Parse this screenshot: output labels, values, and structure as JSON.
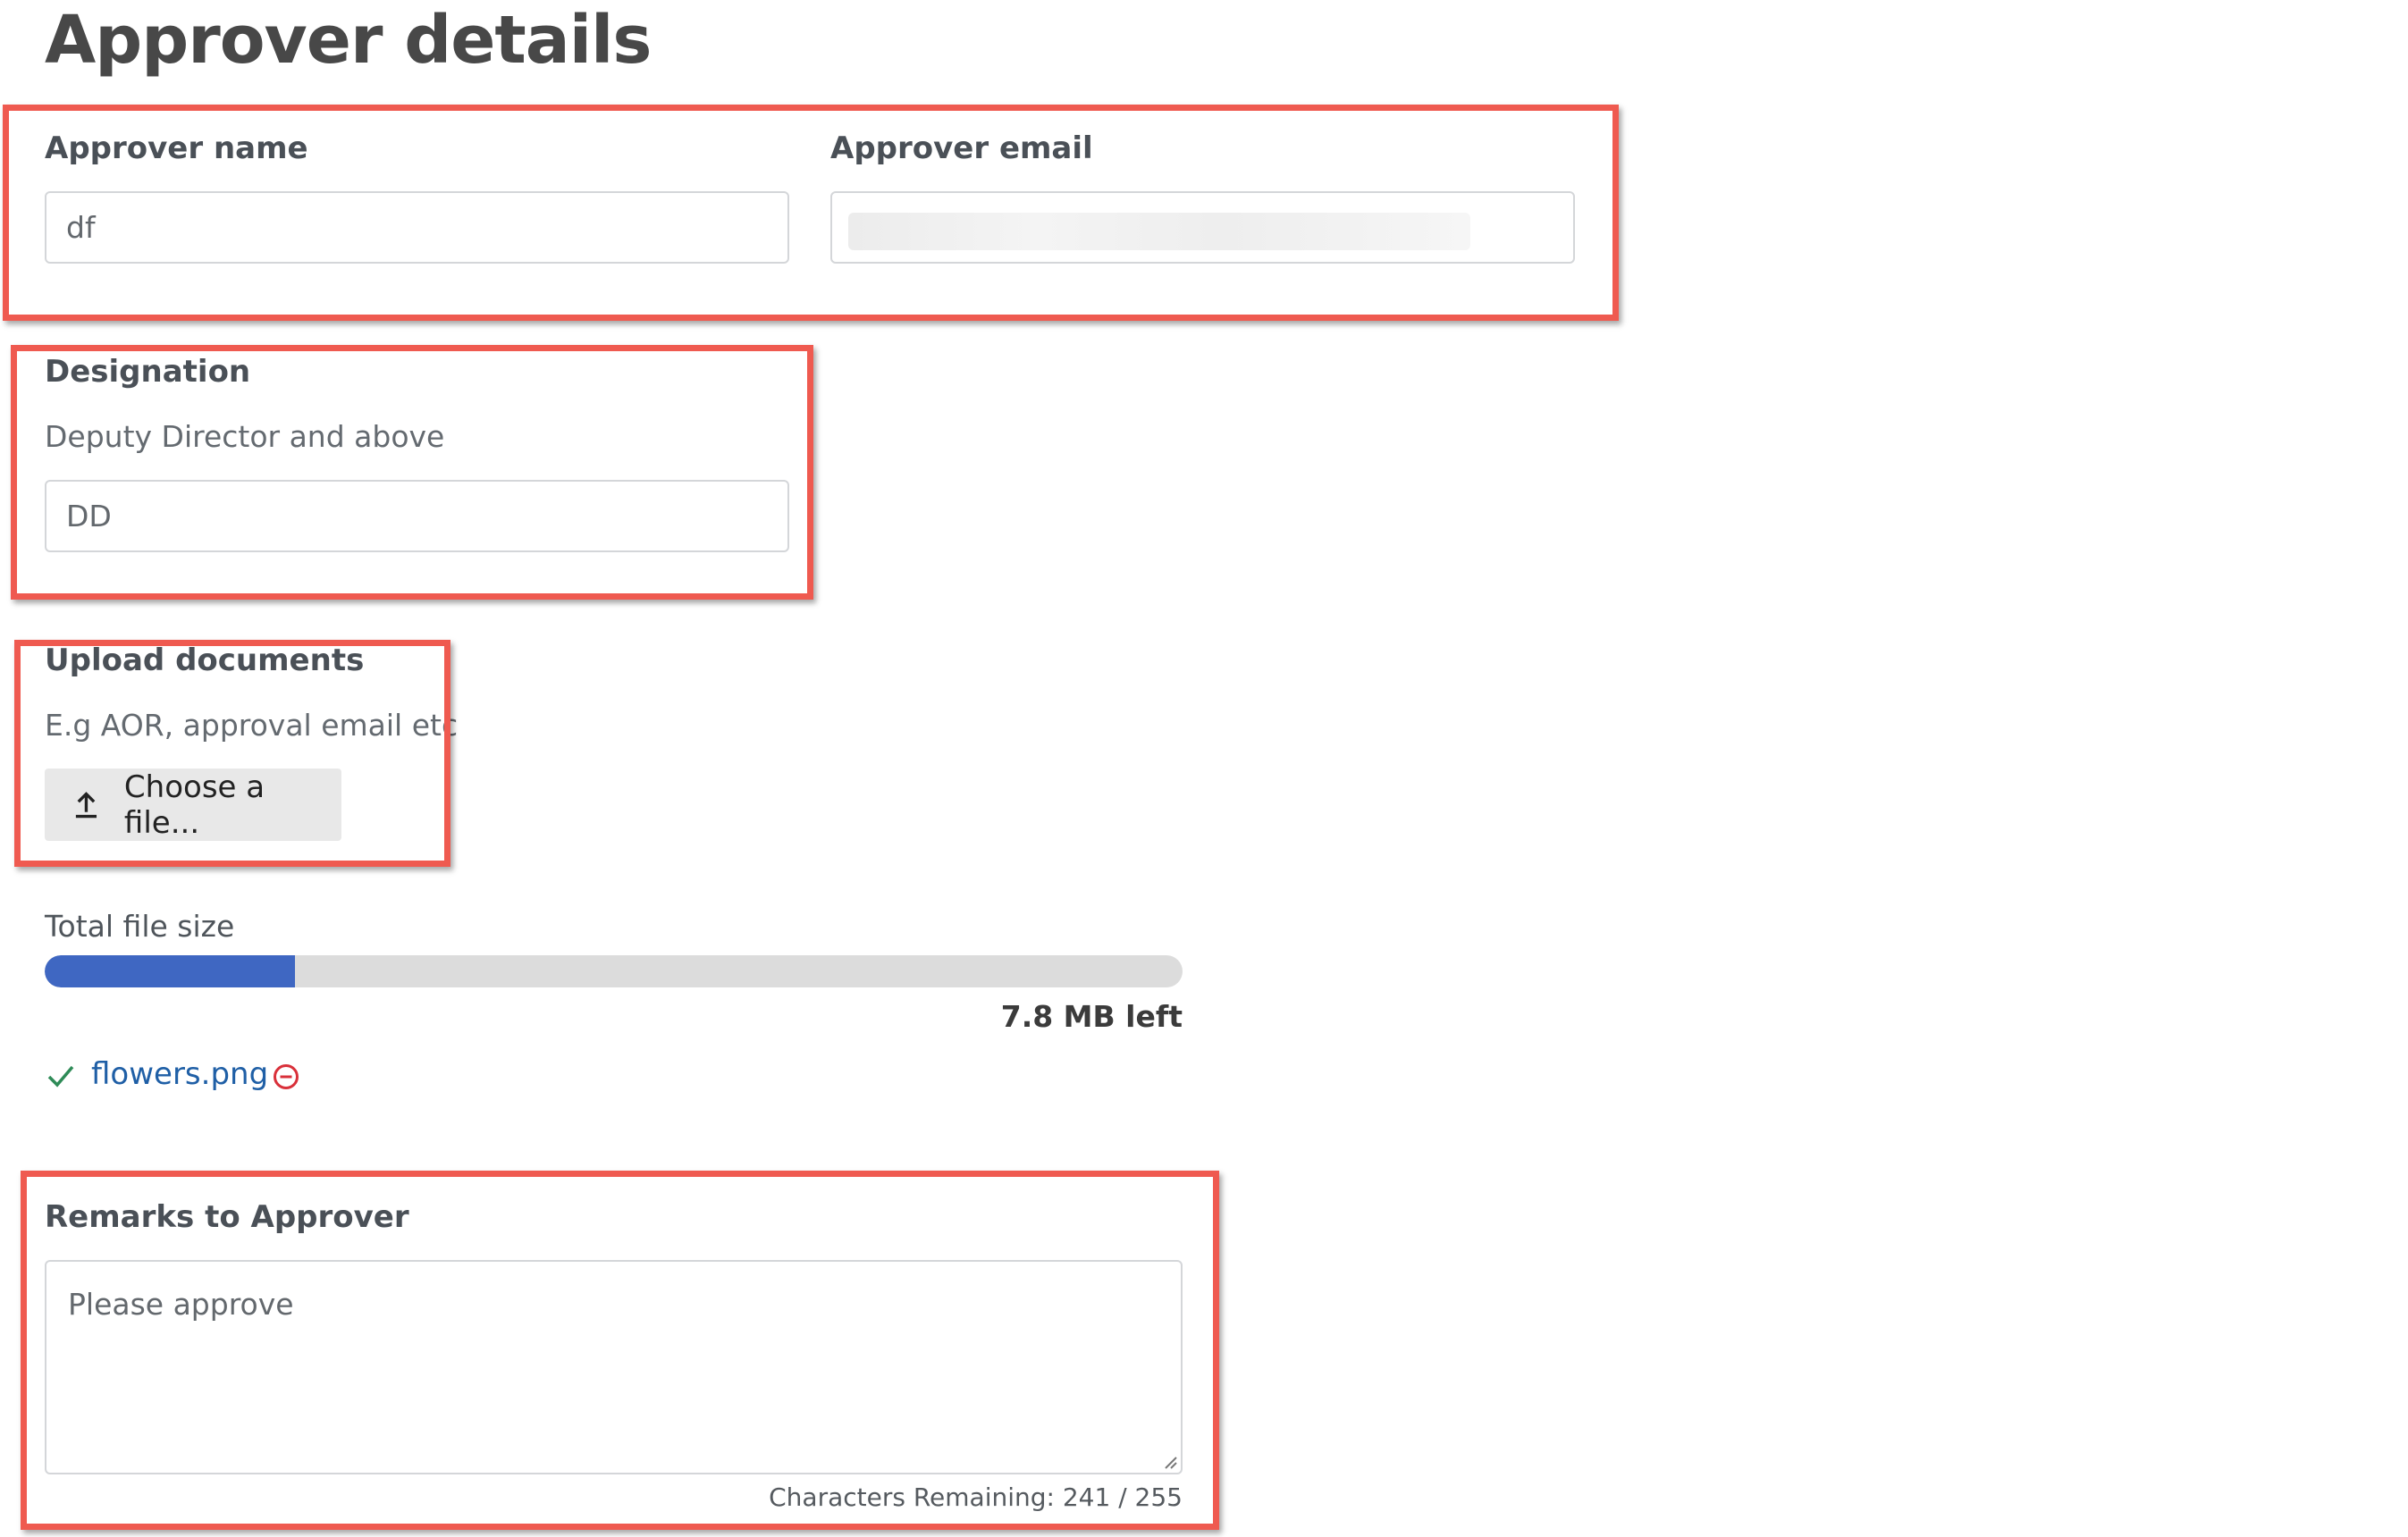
{
  "page": {
    "title": "Approver details"
  },
  "approver_name": {
    "label": "Approver name",
    "value": "df"
  },
  "approver_email": {
    "label": "Approver email",
    "value": ""
  },
  "designation": {
    "label": "Designation",
    "hint": "Deputy Director and above",
    "value": "DD"
  },
  "upload": {
    "label": "Upload documents",
    "hint": "E.g AOR, approval email etc",
    "button_label": "Choose a file...",
    "button_icon": "upload-icon"
  },
  "file_size": {
    "label": "Total file size",
    "used_fraction": 0.22,
    "remaining_text": "7.8 MB left",
    "fill_color": "#3f67c2"
  },
  "uploaded_file": {
    "status_icon": "check-icon",
    "name": "flowers.png",
    "remove_icon": "remove-circle-icon"
  },
  "remarks": {
    "label": "Remarks to Approver",
    "value": "Please approve",
    "char_count": "Characters Remaining: 241 / 255"
  },
  "colors": {
    "annotation_border": "#ef5a50",
    "link": "#1f5fa6",
    "check": "#2e8b57",
    "remove": "#d9303a"
  }
}
